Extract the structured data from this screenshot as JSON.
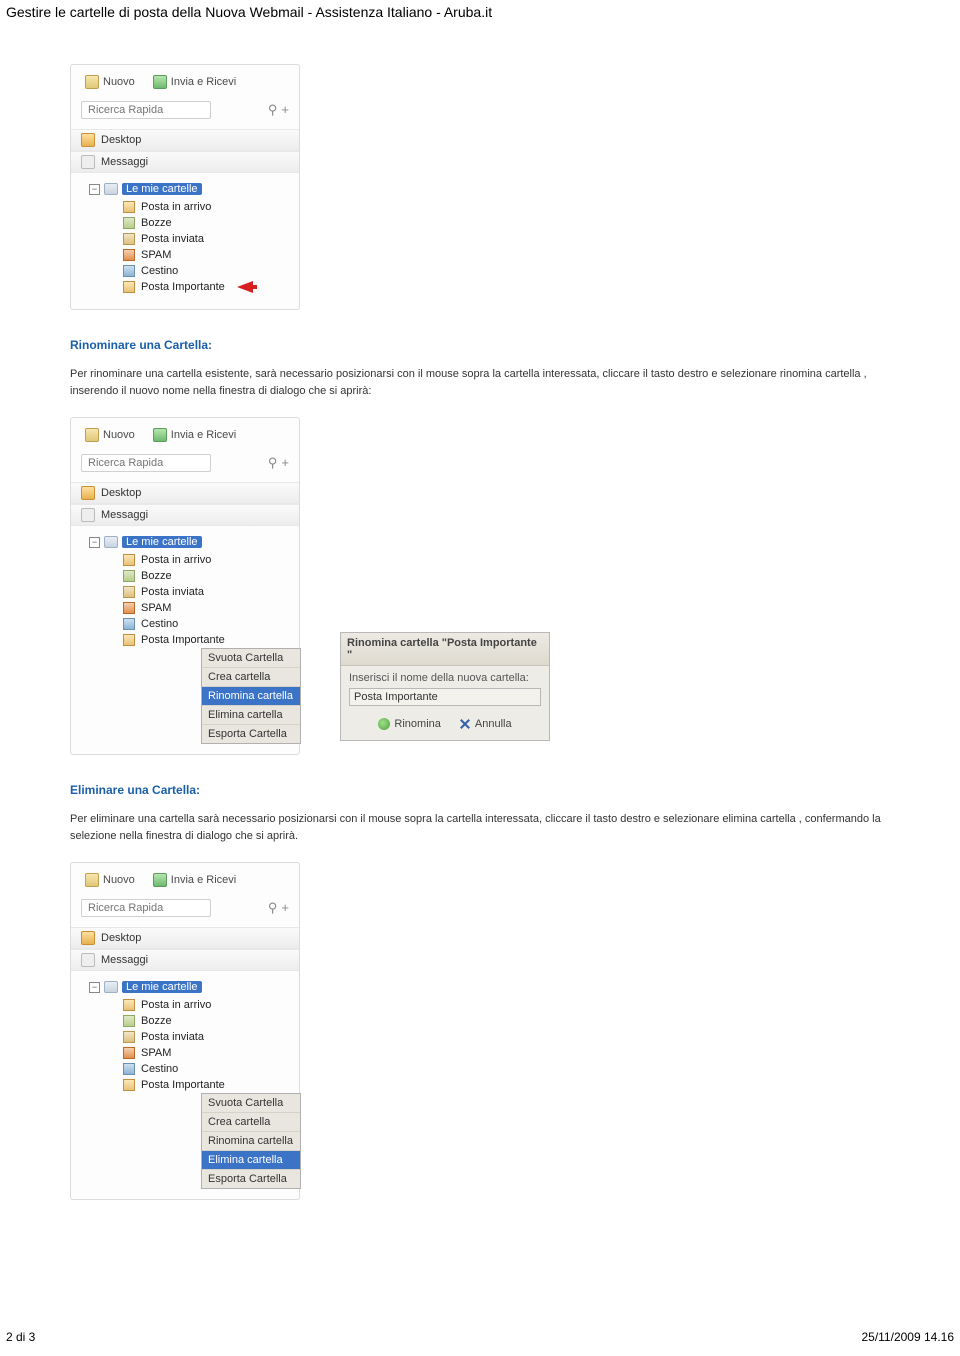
{
  "page_title": "Gestire le cartelle di posta della Nuova Webmail - Assistenza Italiano - Aruba.it",
  "toolbar": {
    "nuovo": "Nuovo",
    "invia": "Invia e Ricevi"
  },
  "search": {
    "placeholder": "Ricerca Rapida"
  },
  "nav": {
    "desktop": "Desktop",
    "messaggi": "Messaggi"
  },
  "tree": {
    "root": "Le mie cartelle",
    "inbox": "Posta in arrivo",
    "drafts": "Bozze",
    "sent": "Posta inviata",
    "spam": "SPAM",
    "trash": "Cestino",
    "important": "Posta Importante"
  },
  "sections": {
    "rename_title": "Rinominare una Cartella:",
    "rename_text": "Per rinominare una cartella esistente, sarà necessario posizionarsi con il mouse sopra la cartella interessata, cliccare il tasto destro e selezionare rinomina cartella , inserendo il nuovo nome nella finestra di dialogo che si aprirà:",
    "delete_title": "Eliminare una Cartella:",
    "delete_text": "Per eliminare una cartella sarà necessario posizionarsi con il mouse sopra la cartella interessata, cliccare il tasto destro e selezionare elimina cartella , confermando la selezione nella finestra di dialogo che si aprirà."
  },
  "context_menu": {
    "empty": "Svuota Cartella",
    "create": "Crea cartella",
    "rename": "Rinomina cartella",
    "delete": "Elimina cartella",
    "export": "Esporta Cartella"
  },
  "dialog": {
    "title": "Rinomina cartella \"Posta Importante \"",
    "label": "Inserisci il nome della nuova cartella:",
    "value": "Posta Importante",
    "ok": "Rinomina",
    "cancel": "Annulla"
  },
  "footer": {
    "page": "2 di 3",
    "datetime": "25/11/2009 14.16"
  }
}
